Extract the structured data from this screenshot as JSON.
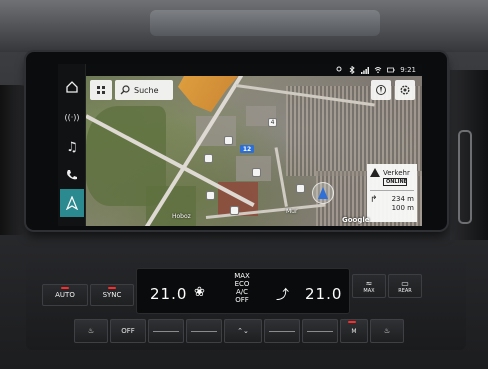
{
  "status_bar": {
    "time": "9:21"
  },
  "side_nav": {
    "items": [
      {
        "id": "home",
        "icon": "home-icon"
      },
      {
        "id": "radio",
        "icon": "radio-icon",
        "label": "((·))"
      },
      {
        "id": "media",
        "icon": "music-icon",
        "label": "♫"
      },
      {
        "id": "phone",
        "icon": "phone-icon"
      },
      {
        "id": "navigation",
        "icon": "navigation-arrow-icon",
        "active": true
      }
    ]
  },
  "map": {
    "search_label": "Suche",
    "road_shield": "12",
    "poi_marker": "4",
    "street_label": "Mur",
    "street_label_left": "Hoboz",
    "provider": "Google"
  },
  "traffic_card": {
    "title": "Verkehr",
    "badge": "ONLINE",
    "distance_1": "234 m",
    "distance_2": "100 m"
  },
  "climate": {
    "auto_label": "AUTO",
    "sync_label": "SYNC",
    "temp_left": "21.0",
    "temp_right": "21.0",
    "ac_lines": [
      "MAX",
      "ECO",
      "A/C",
      "OFF"
    ],
    "max_label": "MAX",
    "rear_label": "REAR",
    "off_label": "OFF",
    "m_label": "M"
  },
  "colors": {
    "accent_active": "#2b8a90",
    "led_red": "#ff2b2b",
    "road_shield_blue": "#2c6fd6"
  }
}
